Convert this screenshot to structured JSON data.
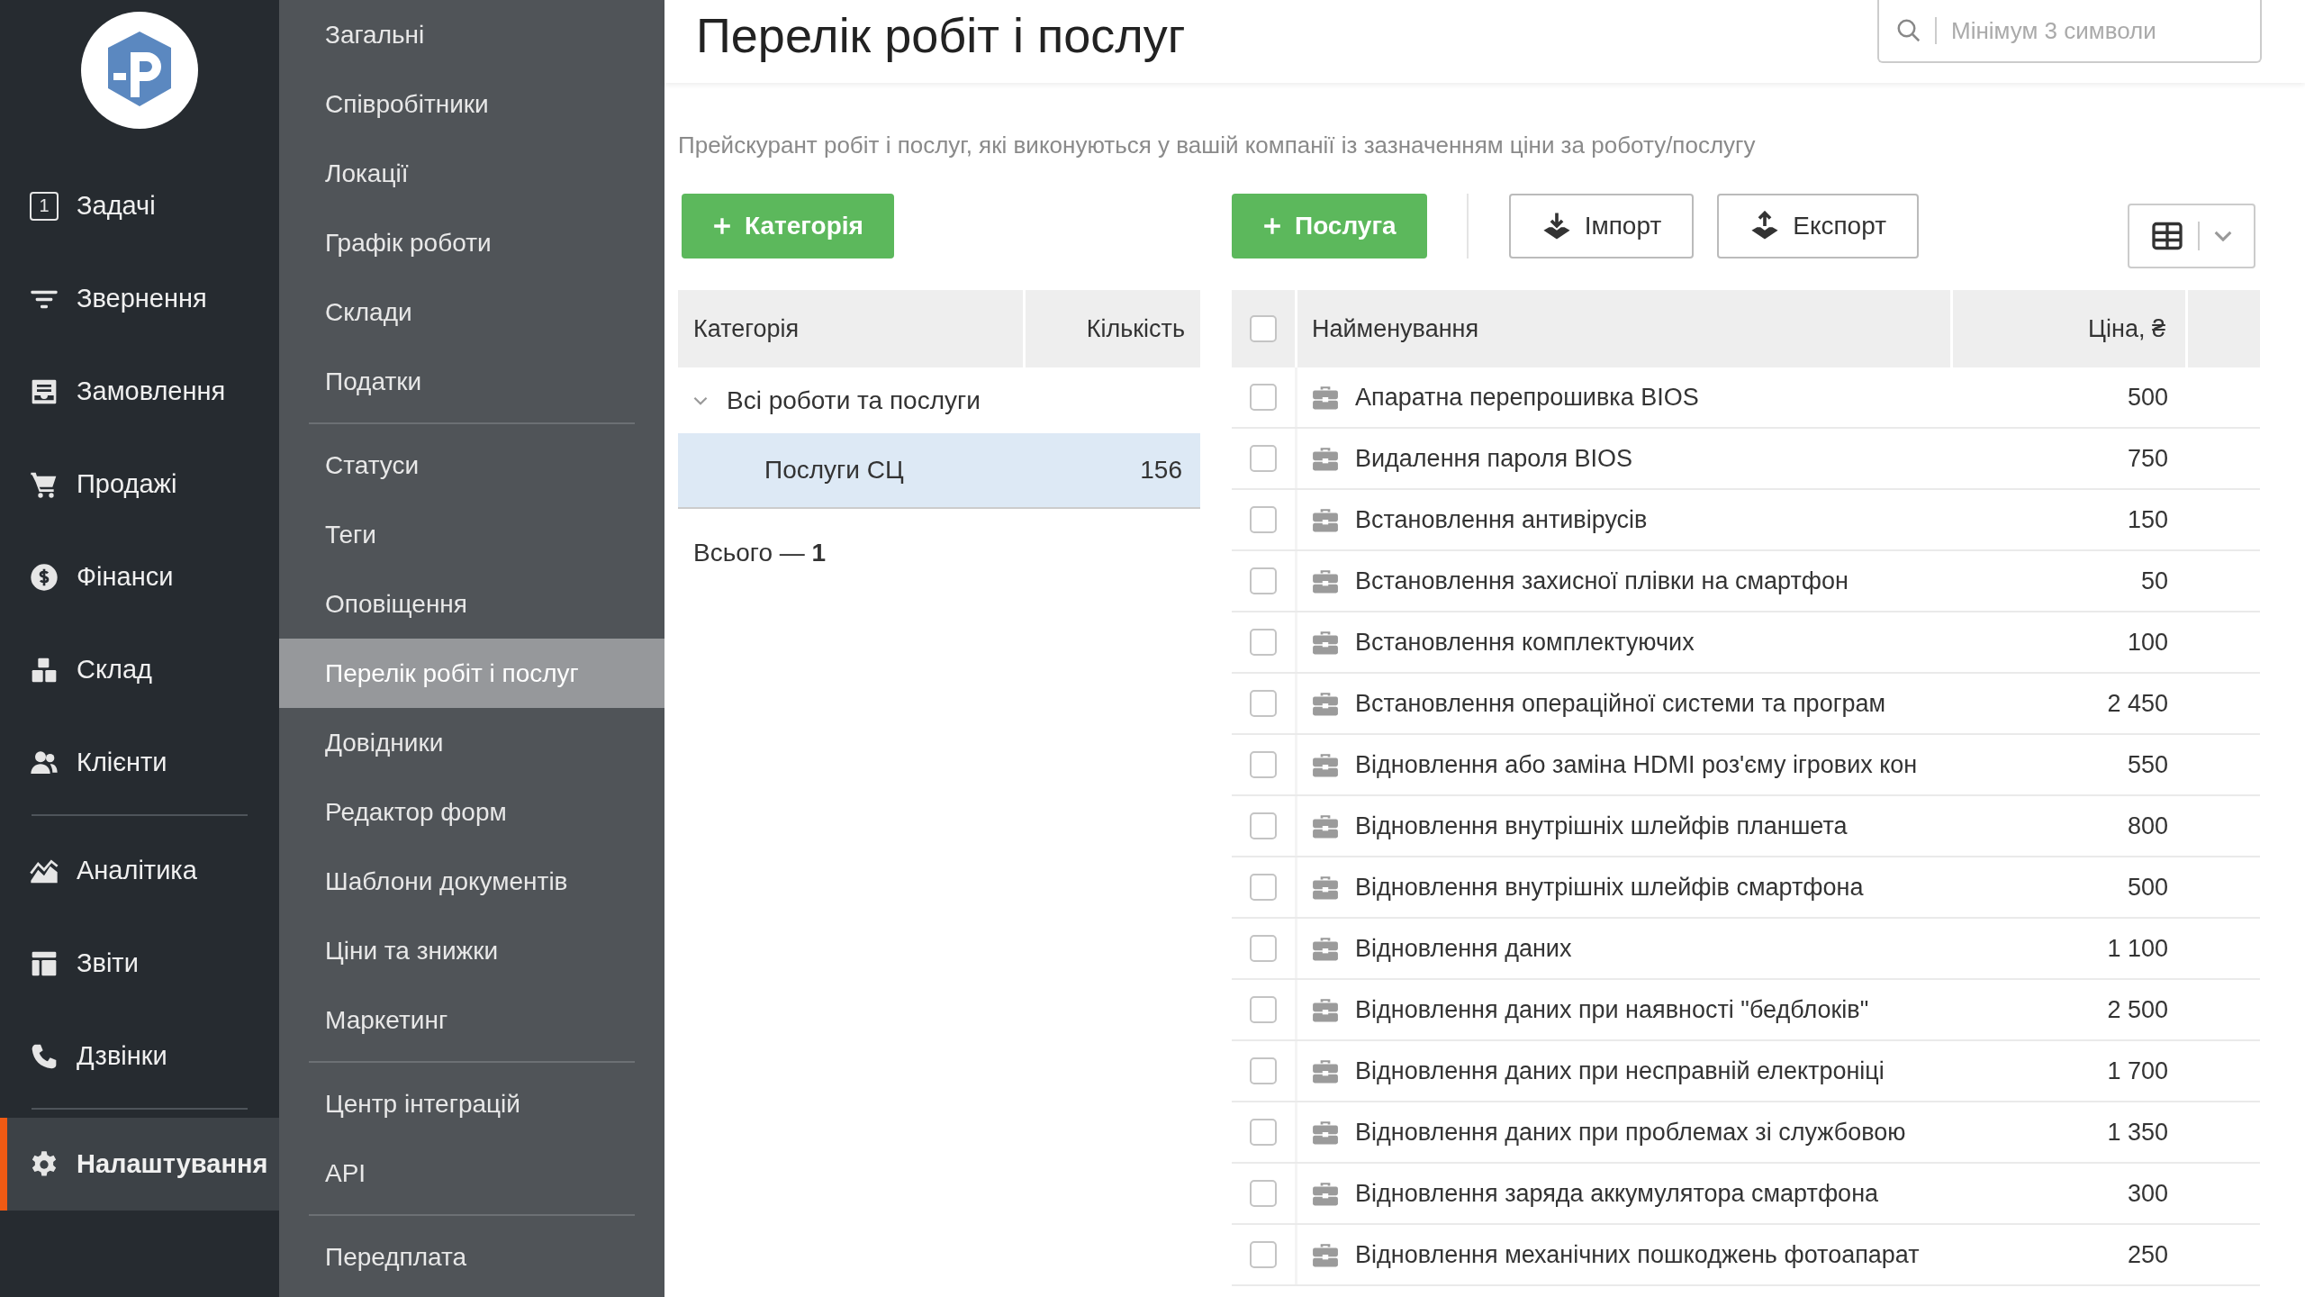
{
  "nav": {
    "items": [
      {
        "label": "Задачі",
        "badge": "1",
        "selected": false
      },
      {
        "label": "Звернення",
        "selected": false
      },
      {
        "label": "Замовлення",
        "selected": false
      },
      {
        "label": "Продажі",
        "selected": false
      },
      {
        "label": "Фінанси",
        "selected": false
      },
      {
        "label": "Склад",
        "selected": false
      },
      {
        "label": "Клієнти",
        "selected": false
      },
      {
        "label": "Аналітика",
        "selected": false
      },
      {
        "label": "Звіти",
        "selected": false
      },
      {
        "label": "Дзвінки",
        "selected": false
      },
      {
        "label": "Налаштування",
        "selected": true
      }
    ]
  },
  "settings_menu": {
    "groups": [
      [
        {
          "label": "Загальні",
          "selected": false
        },
        {
          "label": "Співробітники",
          "selected": false
        },
        {
          "label": "Локації",
          "selected": false
        },
        {
          "label": "Графік роботи",
          "selected": false
        },
        {
          "label": "Склади",
          "selected": false
        },
        {
          "label": "Податки",
          "selected": false
        }
      ],
      [
        {
          "label": "Статуси",
          "selected": false
        },
        {
          "label": "Теги",
          "selected": false
        },
        {
          "label": "Оповіщення",
          "selected": false
        },
        {
          "label": "Перелік робіт і послуг",
          "selected": true
        },
        {
          "label": "Довідники",
          "selected": false
        },
        {
          "label": "Редактор форм",
          "selected": false
        },
        {
          "label": "Шаблони документів",
          "selected": false
        },
        {
          "label": "Ціни та знижки",
          "selected": false
        },
        {
          "label": "Маркетинг",
          "selected": false
        }
      ],
      [
        {
          "label": "Центр інтеграцій",
          "selected": false
        },
        {
          "label": "API",
          "selected": false
        }
      ],
      [
        {
          "label": "Передплата",
          "selected": false
        }
      ]
    ]
  },
  "page": {
    "title": "Перелік робіт і послуг",
    "search": {
      "placeholder": "Мінімум 3 символи"
    },
    "description": "Прейскурант робіт і послуг, які виконуються у вашій компанії із зазначенням ціни за роботу/послугу",
    "buttons": {
      "category": "Категорія",
      "service": "Послуга",
      "import": "Імпорт",
      "export": "Експорт"
    }
  },
  "categories": {
    "columns": [
      "Категорія",
      "Кількість"
    ],
    "tree": [
      {
        "label": "Всі роботи та послуги",
        "expanded": true,
        "children": [
          {
            "label": "Послуги СЦ",
            "count": "156",
            "selected": true
          }
        ]
      }
    ],
    "total": "Всього — **1**"
  },
  "services": {
    "columns": [
      "Найменування",
      "Ціна, ₴"
    ],
    "all_checked": false,
    "rows": [
      {
        "name": "Апаратна перепрошивка BIOS",
        "price": "500",
        "checked": false
      },
      {
        "name": "Видалення пароля BIOS",
        "price": "750",
        "checked": false
      },
      {
        "name": "Встановлення антивірусів",
        "price": "150",
        "checked": false
      },
      {
        "name": "Встановлення захисної плівки на смартфон",
        "price": "50",
        "checked": false
      },
      {
        "name": "Встановлення комплектуючих",
        "price": "100",
        "checked": false
      },
      {
        "name": "Встановлення операційної системи та програм",
        "price": "2 450",
        "checked": false
      },
      {
        "name": "Відновлення або заміна HDMI роз'єму ігрових кон",
        "price": "550",
        "checked": false
      },
      {
        "name": "Відновлення внутрішніх шлейфів планшета",
        "price": "800",
        "checked": false
      },
      {
        "name": "Відновлення внутрішніх шлейфів смартфона",
        "price": "500",
        "checked": false
      },
      {
        "name": "Відновлення даних",
        "price": "1 100",
        "checked": false
      },
      {
        "name": "Відновлення даних при наявності \"бедблоків\"",
        "price": "2 500",
        "checked": false
      },
      {
        "name": "Відновлення даних при несправній електроніці",
        "price": "1 700",
        "checked": false
      },
      {
        "name": "Відновлення даних при проблемах зі службовою",
        "price": "1 350",
        "checked": false
      },
      {
        "name": "Відновлення заряда аккумулятора смартфона",
        "price": "300",
        "checked": false
      },
      {
        "name": "Відновлення механічних пошкоджень фотоапарат",
        "price": "250",
        "checked": false
      }
    ]
  }
}
